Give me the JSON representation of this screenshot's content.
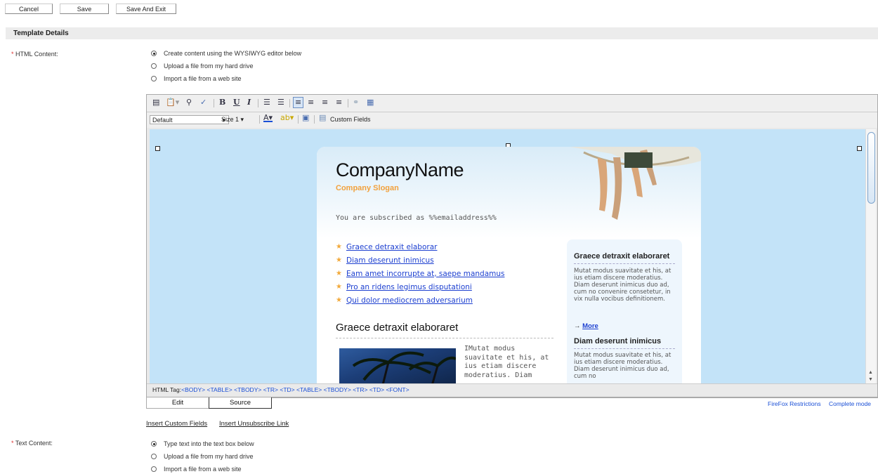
{
  "buttons": {
    "cancel": "Cancel",
    "save": "Save",
    "save_exit": "Save And Exit"
  },
  "section": {
    "title": "Template Details"
  },
  "html_content": {
    "required_mark": "*",
    "label": "HTML Content:",
    "options": [
      {
        "label": "Create content using the WYSIWYG editor below",
        "selected": true
      },
      {
        "label": "Upload a file from my hard drive",
        "selected": false
      },
      {
        "label": "Import a file from a web site",
        "selected": false
      }
    ]
  },
  "toolbar": {
    "font_select": "Default",
    "size_select": "Size 1",
    "custom_fields": "Custom Fields",
    "icons": [
      "insert-template-icon",
      "paste-icon",
      "find-icon",
      "spellcheck-icon",
      "bold-icon",
      "underline-icon",
      "italic-icon",
      "ordered-list-icon",
      "unordered-list-icon",
      "align-left-icon",
      "align-center-icon",
      "align-right-icon",
      "justify-icon",
      "link-icon",
      "table-icon",
      "font-color-icon",
      "highlight-icon",
      "insert-image-icon",
      "custom-fields-icon"
    ]
  },
  "email": {
    "company_name": "CompanyName",
    "slogan": "Company Slogan",
    "subscribed": "You are subscribed as %%emailaddress%%",
    "links": [
      "Graece detraxit elaborar",
      "Diam deserunt inimicus",
      "Eam amet incorrupte at, saepe mandamus",
      "Pro an ridens legimus disputationi",
      "Qui dolor mediocrem adversarium"
    ],
    "headline": "Graece detraxit elaboraret",
    "body_text": "IMutat modus suavitate et his, at ius etiam discere moderatius. Diam",
    "sidebar": {
      "heading1": "Graece detraxit elaboraret",
      "text1": "Mutat modus suavitate et his, at ius etiam discere moderatius. Diam deserunt inimicus duo ad, cum no convenire consetetur, in vix nulla vocibus definitionem.",
      "more": "More",
      "heading2": "Diam deserunt inimicus",
      "text2": "Mutat modus suavitate et his, at ius etiam discere moderatius. Diam deserunt inimicus duo ad, cum no"
    }
  },
  "tagbar": {
    "prefix": "HTML Tag:",
    "tags": [
      "<BODY>",
      "<TABLE>",
      "<TBODY>",
      "<TR>",
      "<TD>",
      "<TABLE>",
      "<TBODY>",
      "<TR>",
      "<TD>",
      "<FONT>"
    ]
  },
  "editor_tabs": {
    "edit": "Edit",
    "source": "Source"
  },
  "editor_links": {
    "firefox": "FireFox Restrictions",
    "complete": "Complete mode"
  },
  "insert_links": {
    "custom_fields": "Insert Custom Fields",
    "unsubscribe": "Insert Unsubscribe Link"
  },
  "text_content": {
    "required_mark": "*",
    "label": "Text Content:",
    "options": [
      {
        "label": "Type text into the text box below",
        "selected": true
      },
      {
        "label": "Upload a file from my hard drive",
        "selected": false
      },
      {
        "label": "Import a file from a web site",
        "selected": false
      }
    ]
  }
}
